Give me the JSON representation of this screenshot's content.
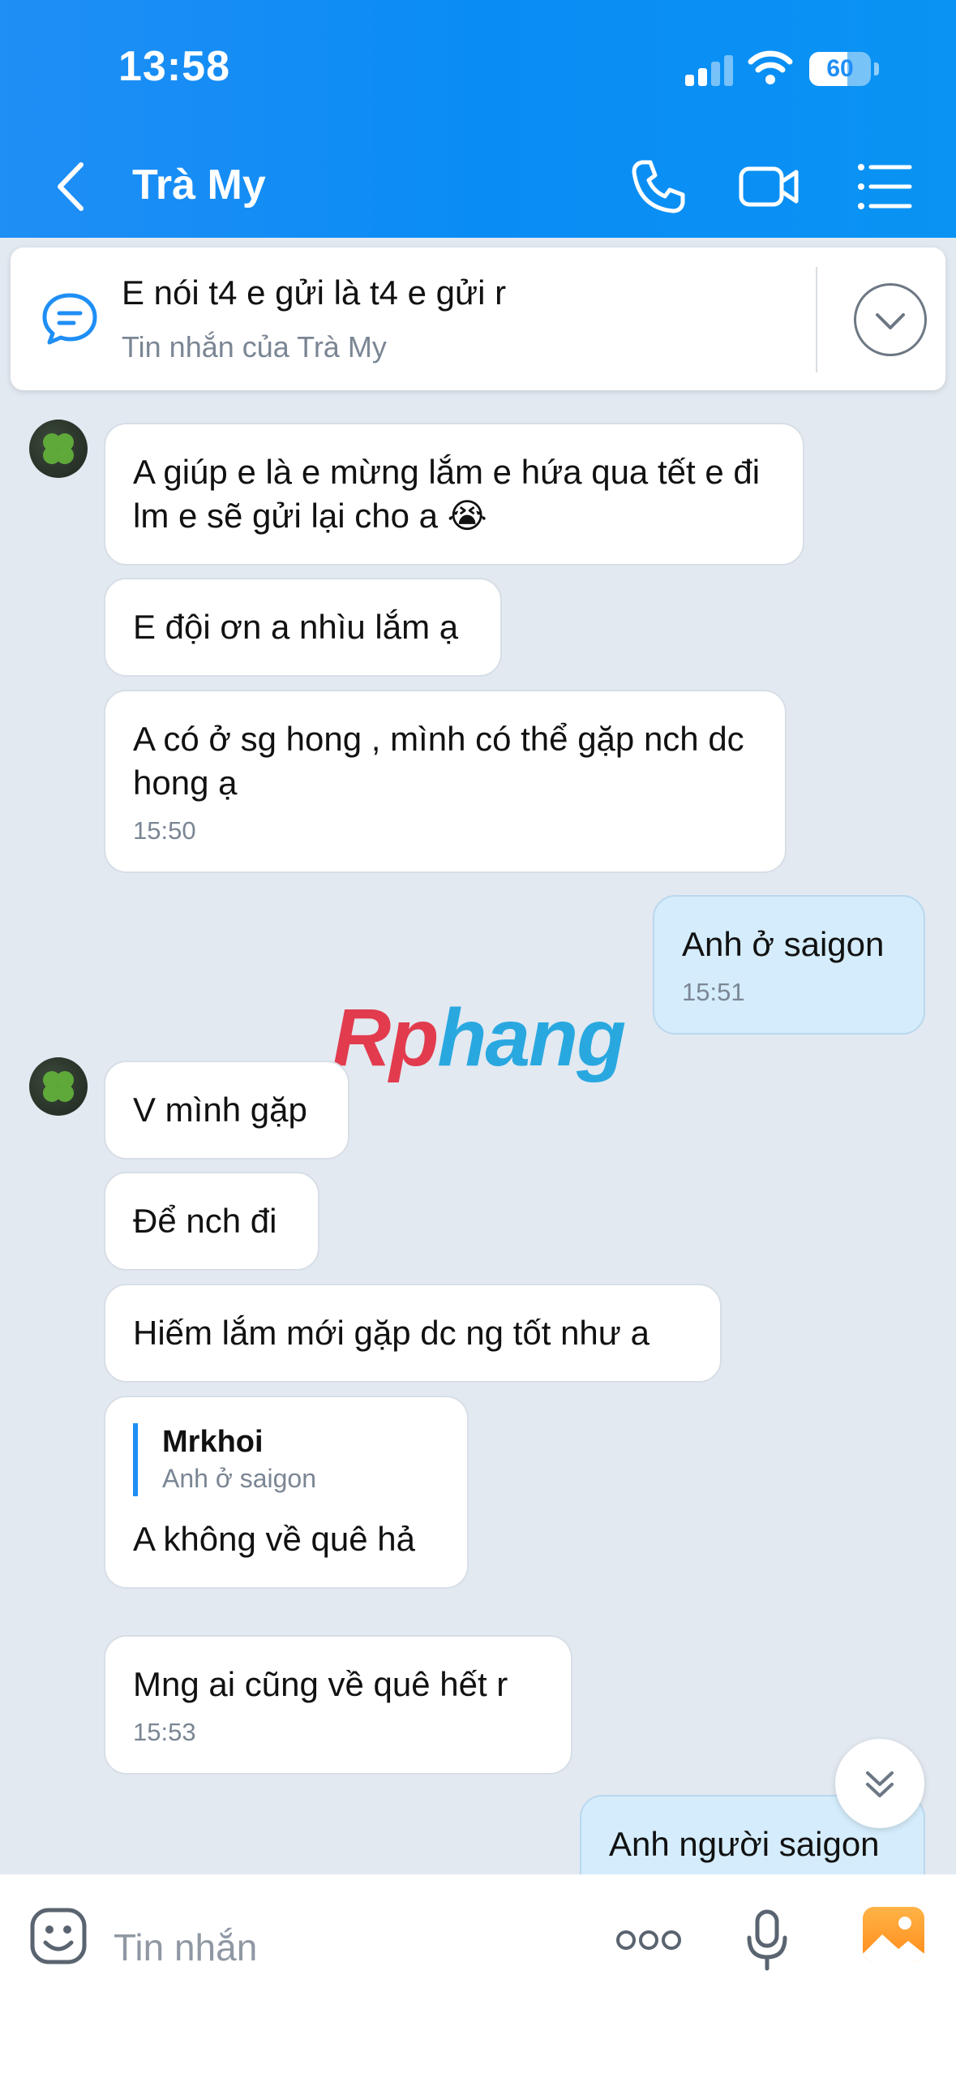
{
  "status_bar": {
    "time": "13:58",
    "battery": "60"
  },
  "header": {
    "title": "Trà My",
    "accent": "#1f8ef5"
  },
  "pinned": {
    "text": "E nói t4 e gửi là t4 e gửi r",
    "subtitle": "Tin nhắn của Trà My"
  },
  "messages": [
    {
      "from": "them",
      "text": "A giúp e là e mừng lắm e hứa qua tết e đi lm e sẽ gửi lại cho a 😭"
    },
    {
      "from": "them",
      "text": "E đội ơn a nhìu lắm ạ"
    },
    {
      "from": "them",
      "text": "A có ở sg hong , mình có thể gặp nch dc hong ạ",
      "time": "15:50"
    },
    {
      "from": "me",
      "text": "Anh ở saigon",
      "time": "15:51"
    },
    {
      "from": "them",
      "text": "V mình gặp"
    },
    {
      "from": "them",
      "text": "Để nch đi"
    },
    {
      "from": "them",
      "text": "Hiếm lắm mới gặp dc ng tốt như a"
    },
    {
      "from": "them",
      "text": "A không về quê hả",
      "quote_name": "Mrkhoi",
      "quote_text": "Anh ở saigon"
    },
    {
      "from": "them",
      "text": "Mng ai cũng về quê hết r",
      "time": "15:53"
    },
    {
      "from": "me",
      "text": "Anh người saigon"
    }
  ],
  "watermark": {
    "part1": "Rp",
    "part2": "hang"
  },
  "composer": {
    "placeholder": "Tin nhắn",
    "more_label": "ooo"
  },
  "icons": [
    "back-arrow-icon",
    "phone-icon",
    "video-call-icon",
    "list-menu-icon",
    "chat-bubble-icon",
    "chevron-down-icon",
    "emoji-icon",
    "microphone-icon",
    "image-icon",
    "double-chevron-down-icon"
  ]
}
